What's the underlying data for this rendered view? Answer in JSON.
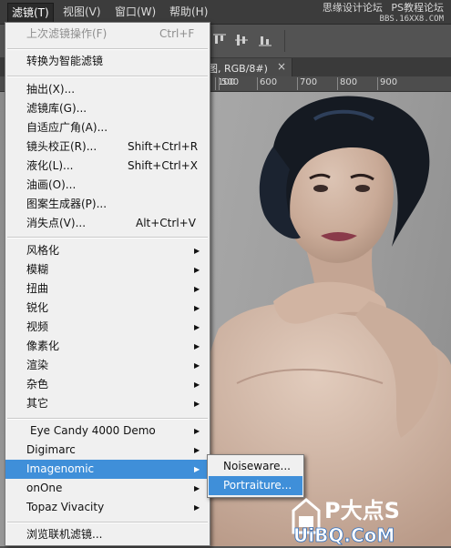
{
  "menubar": {
    "items": [
      "滤镜(T)",
      "视图(V)",
      "窗口(W)",
      "帮助(H)"
    ],
    "active_index": 0
  },
  "watermark": {
    "line1": "思缘设计论坛",
    "line2": "PS教程论坛",
    "line3": "BBS.16XX8.COM"
  },
  "document_tab": {
    "title": "图, RGB/8#)",
    "close": "×"
  },
  "ruler": {
    "ticks": [
      "100",
      "500",
      "600",
      "700",
      "800",
      "900"
    ]
  },
  "filter_menu": {
    "last_filter": {
      "label": "上次滤镜操作(F)",
      "shortcut": "Ctrl+F"
    },
    "smart_filter": "转换为智能滤镜",
    "group1": [
      {
        "label": "抽出(X)...",
        "shortcut": ""
      },
      {
        "label": "滤镜库(G)...",
        "shortcut": ""
      },
      {
        "label": "自适应广角(A)...",
        "shortcut": ""
      },
      {
        "label": "镜头校正(R)...",
        "shortcut": "Shift+Ctrl+R"
      },
      {
        "label": "液化(L)...",
        "shortcut": "Shift+Ctrl+X"
      },
      {
        "label": "油画(O)...",
        "shortcut": ""
      },
      {
        "label": "图案生成器(P)...",
        "shortcut": ""
      },
      {
        "label": "消失点(V)...",
        "shortcut": "Alt+Ctrl+V"
      }
    ],
    "group2": [
      "风格化",
      "模糊",
      "扭曲",
      "锐化",
      "视频",
      "像素化",
      "渲染",
      "杂色",
      "其它"
    ],
    "group3": [
      "Eye Candy 4000  Demo",
      "Digimarc",
      "Imagenomic",
      "onOne",
      "Topaz Vivacity"
    ],
    "highlighted": "Imagenomic",
    "browse": "浏览联机滤镜..."
  },
  "submenu": {
    "items": [
      "Noiseware...",
      "Portraiture..."
    ],
    "highlighted": "Portraiture..."
  },
  "logo": {
    "text1": "P大点S",
    "text2": "UiBQ.CoM"
  },
  "colors": {
    "menu_bg": "#f0f0f0",
    "highlight": "#3f8fd9",
    "app_bg": "#535353"
  }
}
